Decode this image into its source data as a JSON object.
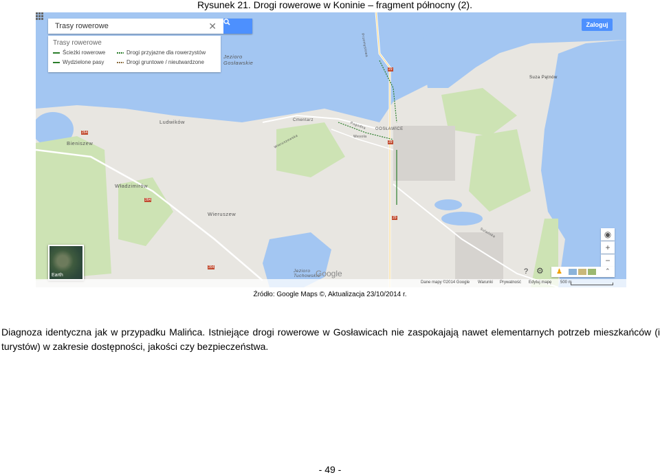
{
  "caption": "Rysunek 21. Drogi rowerowe w Koninie – fragment północny (2).",
  "map": {
    "search_value": "Trasy rowerowe",
    "legend_title": "Trasy rowerowe",
    "legend_items": [
      {
        "label": "Ścieżki rowerowe",
        "color": "#2a7d2a"
      },
      {
        "label": "Drogi przyjazne dla rowerzystów",
        "color": "#2a7d2a"
      },
      {
        "label": "Wydzielone pasy",
        "color": "#2a7d2a"
      },
      {
        "label": "Drogi gruntowe / nieutwardzone",
        "color": "#8a6b3c"
      }
    ],
    "signin_label": "Zaloguj",
    "earth_label": "Earth",
    "place_labels": [
      "Jezioro Gosławskie",
      "Ludwików",
      "Bieniszew",
      "Władzimirów",
      "Wieruszew",
      "Cmentarz",
      "GOSŁAWICE",
      "Suza Pątnów",
      "Jezioro Tuchowskie",
      "Przemysłowa",
      "Wieruszewska",
      "Pogodna",
      "Wesoła",
      "Sulańska"
    ],
    "road_numbers": [
      "264",
      "264",
      "264",
      "29",
      "29",
      "29"
    ],
    "google_logo": "Google",
    "attribution": "Dane mapy ©2014 Google",
    "links": [
      "Warunki",
      "Prywatność",
      "Edytuj mapę"
    ],
    "scale": "500 m",
    "colors": {
      "water": "#a3c6f2",
      "land": "#e8e6e1",
      "green": "#cde3b4",
      "road": "#ffffff",
      "accent": "#4d90fe"
    }
  },
  "source": "Źródło: Google Maps ©, Aktualizacja 23/10/2014 r.",
  "paragraph": "Diagnoza identyczna jak w przypadku Malińca. Istniejące drogi rowerowe w Gosławicach nie zaspokajają nawet elementarnych potrzeb mieszkańców (i turystów) w zakresie dostępności, jakości czy bezpieczeństwa.",
  "page_number": "- 49 -"
}
